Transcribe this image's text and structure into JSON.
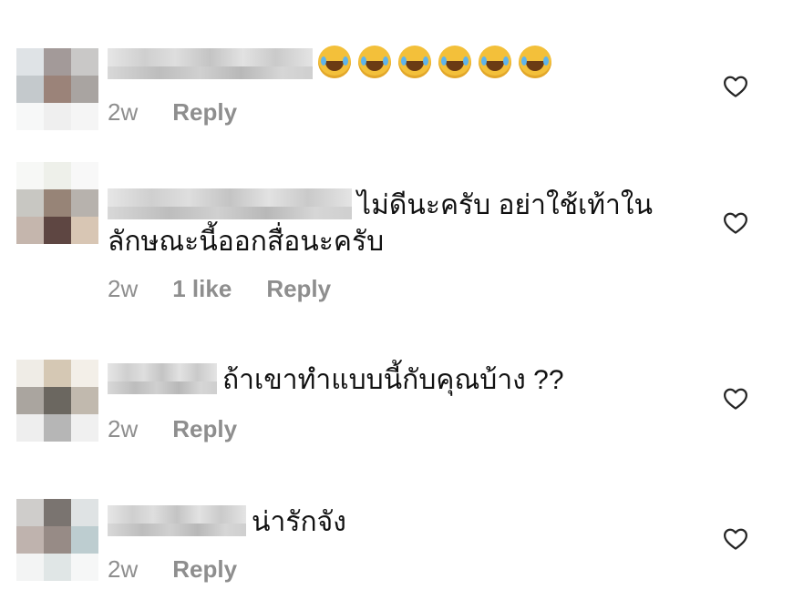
{
  "comments": [
    {
      "name_blurred": true,
      "text": "",
      "emoji_count": 6,
      "emoji_icon": "face-with-tears-of-joy",
      "time": "2w",
      "likes": "",
      "reply": "Reply",
      "avatar_colors": [
        "#dfe3e6",
        "#a39a99",
        "#c9c8c7",
        "#c4c9cc",
        "#9b8379",
        "#a9a4a1",
        "#f7f8f8",
        "#efefef",
        "#f5f5f5"
      ]
    },
    {
      "name_blurred": true,
      "text": "ไม่ดีนะครับ อย่าใช้เท้าในลักษณะนี้ออกสื่อนะครับ",
      "time": "2w",
      "likes": "1 like",
      "reply": "Reply",
      "avatar_colors": [
        "#f7f8f6",
        "#eef0ea",
        "#f8f8f8",
        "#c8c7c2",
        "#978477",
        "#b7b2ad",
        "#c5b6ad",
        "#5e4642",
        "#d8c6b4"
      ]
    },
    {
      "name_blurred": true,
      "text": "ถ้าเขาทำแบบนี้กับคุณบ้าง ??",
      "time": "2w",
      "likes": "",
      "reply": "Reply",
      "avatar_colors": [
        "#efece6",
        "#d5c8b4",
        "#f3efe8",
        "#aaa59f",
        "#6b6760",
        "#c1b9ae",
        "#eeeeee",
        "#b6b6b6",
        "#f0f0f0"
      ]
    },
    {
      "name_blurred": true,
      "text": "น่ารักจัง",
      "time": "2w",
      "likes": "",
      "reply": "Reply",
      "avatar_colors": [
        "#cfcdcb",
        "#7a7470",
        "#dfe3e4",
        "#bfb3ae",
        "#978b86",
        "#bdcdd0",
        "#f3f4f4",
        "#e0e6e6",
        "#f6f7f7"
      ]
    }
  ],
  "icons": {
    "like": "heart-outline-icon"
  }
}
